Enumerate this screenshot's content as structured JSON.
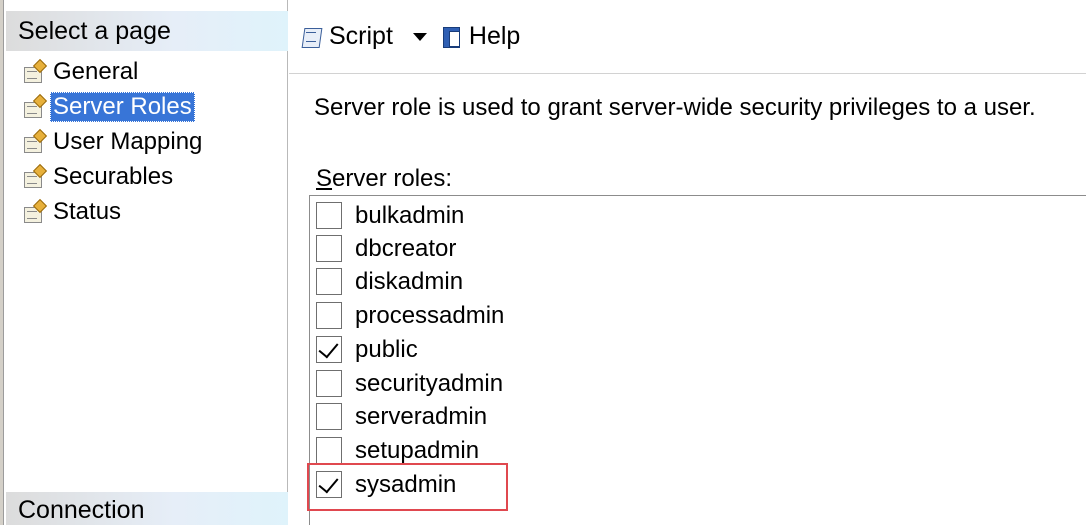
{
  "left_panel": {
    "select_page_header": "Select a page",
    "nav_items": [
      {
        "label": "General"
      },
      {
        "label": "Server Roles"
      },
      {
        "label": "User Mapping"
      },
      {
        "label": "Securables"
      },
      {
        "label": "Status"
      }
    ],
    "selected": "Server Roles",
    "connection_header": "Connection"
  },
  "toolbar": {
    "script_label": "Script",
    "help_label": "Help"
  },
  "main": {
    "description": "Server role is used to grant server-wide security privileges to a user.",
    "roles_label": "Server roles:",
    "roles": [
      {
        "name": "bulkadmin",
        "checked": false
      },
      {
        "name": "dbcreator",
        "checked": false
      },
      {
        "name": "diskadmin",
        "checked": false
      },
      {
        "name": "processadmin",
        "checked": false
      },
      {
        "name": "public",
        "checked": true
      },
      {
        "name": "securityadmin",
        "checked": false
      },
      {
        "name": "serveradmin",
        "checked": false
      },
      {
        "name": "setupadmin",
        "checked": false
      },
      {
        "name": "sysadmin",
        "checked": true
      }
    ],
    "highlighted_role": "sysadmin"
  },
  "colors": {
    "selection": "#3875d7",
    "highlight_border": "#e0484f"
  }
}
